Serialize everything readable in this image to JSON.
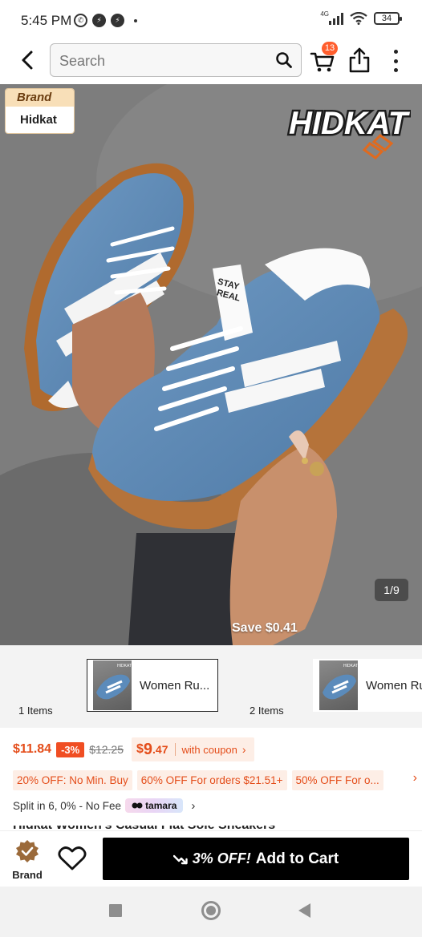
{
  "status_bar": {
    "time": "5:45 PM",
    "network": "4G",
    "battery": "34"
  },
  "header": {
    "search_placeholder": "Search",
    "cart_count": "13"
  },
  "gallery": {
    "brand_tag_label": "Brand",
    "brand_name": "Hidkat",
    "logo_text": "HIDKAT",
    "counter": "1/9",
    "save_text": "Save $0.41"
  },
  "variants": [
    {
      "count": "1 Items",
      "name": "Women Ru..."
    },
    {
      "count": "2 Items",
      "name": "Women Ru"
    }
  ],
  "pricing": {
    "price": "$11.84",
    "discount": "-3%",
    "original": "$12.25",
    "coupon_dollar": "$",
    "coupon_whole": "9",
    "coupon_cents": ".47",
    "coupon_label": "with coupon"
  },
  "promos": [
    "20% OFF: No Min. Buy",
    "60% OFF For orders $21.51+",
    "50% OFF For o..."
  ],
  "split": {
    "text": "Split in 6, 0% - No Fee",
    "provider": "tamara"
  },
  "title_peek": "Hidkat Women's Casual Flat Sole Sneakers",
  "bottom_bar": {
    "brand_label": "Brand",
    "add_to_cart_prefix": "3% OFF!",
    "add_to_cart_label": "Add to Cart"
  },
  "colors": {
    "accent": "#e44d1a",
    "badge": "#ff5e2e",
    "cta": "#000000"
  }
}
